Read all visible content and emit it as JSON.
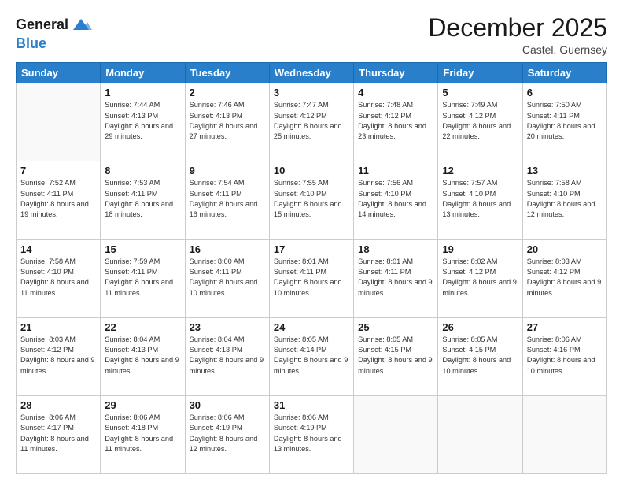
{
  "header": {
    "logo_line1": "General",
    "logo_line2": "Blue",
    "month": "December 2025",
    "location": "Castel, Guernsey"
  },
  "weekdays": [
    "Sunday",
    "Monday",
    "Tuesday",
    "Wednesday",
    "Thursday",
    "Friday",
    "Saturday"
  ],
  "weeks": [
    [
      {
        "day": "",
        "sunrise": "",
        "sunset": "",
        "daylight": ""
      },
      {
        "day": "1",
        "sunrise": "Sunrise: 7:44 AM",
        "sunset": "Sunset: 4:13 PM",
        "daylight": "Daylight: 8 hours and 29 minutes."
      },
      {
        "day": "2",
        "sunrise": "Sunrise: 7:46 AM",
        "sunset": "Sunset: 4:13 PM",
        "daylight": "Daylight: 8 hours and 27 minutes."
      },
      {
        "day": "3",
        "sunrise": "Sunrise: 7:47 AM",
        "sunset": "Sunset: 4:12 PM",
        "daylight": "Daylight: 8 hours and 25 minutes."
      },
      {
        "day": "4",
        "sunrise": "Sunrise: 7:48 AM",
        "sunset": "Sunset: 4:12 PM",
        "daylight": "Daylight: 8 hours and 23 minutes."
      },
      {
        "day": "5",
        "sunrise": "Sunrise: 7:49 AM",
        "sunset": "Sunset: 4:12 PM",
        "daylight": "Daylight: 8 hours and 22 minutes."
      },
      {
        "day": "6",
        "sunrise": "Sunrise: 7:50 AM",
        "sunset": "Sunset: 4:11 PM",
        "daylight": "Daylight: 8 hours and 20 minutes."
      }
    ],
    [
      {
        "day": "7",
        "sunrise": "Sunrise: 7:52 AM",
        "sunset": "Sunset: 4:11 PM",
        "daylight": "Daylight: 8 hours and 19 minutes."
      },
      {
        "day": "8",
        "sunrise": "Sunrise: 7:53 AM",
        "sunset": "Sunset: 4:11 PM",
        "daylight": "Daylight: 8 hours and 18 minutes."
      },
      {
        "day": "9",
        "sunrise": "Sunrise: 7:54 AM",
        "sunset": "Sunset: 4:11 PM",
        "daylight": "Daylight: 8 hours and 16 minutes."
      },
      {
        "day": "10",
        "sunrise": "Sunrise: 7:55 AM",
        "sunset": "Sunset: 4:10 PM",
        "daylight": "Daylight: 8 hours and 15 minutes."
      },
      {
        "day": "11",
        "sunrise": "Sunrise: 7:56 AM",
        "sunset": "Sunset: 4:10 PM",
        "daylight": "Daylight: 8 hours and 14 minutes."
      },
      {
        "day": "12",
        "sunrise": "Sunrise: 7:57 AM",
        "sunset": "Sunset: 4:10 PM",
        "daylight": "Daylight: 8 hours and 13 minutes."
      },
      {
        "day": "13",
        "sunrise": "Sunrise: 7:58 AM",
        "sunset": "Sunset: 4:10 PM",
        "daylight": "Daylight: 8 hours and 12 minutes."
      }
    ],
    [
      {
        "day": "14",
        "sunrise": "Sunrise: 7:58 AM",
        "sunset": "Sunset: 4:10 PM",
        "daylight": "Daylight: 8 hours and 11 minutes."
      },
      {
        "day": "15",
        "sunrise": "Sunrise: 7:59 AM",
        "sunset": "Sunset: 4:11 PM",
        "daylight": "Daylight: 8 hours and 11 minutes."
      },
      {
        "day": "16",
        "sunrise": "Sunrise: 8:00 AM",
        "sunset": "Sunset: 4:11 PM",
        "daylight": "Daylight: 8 hours and 10 minutes."
      },
      {
        "day": "17",
        "sunrise": "Sunrise: 8:01 AM",
        "sunset": "Sunset: 4:11 PM",
        "daylight": "Daylight: 8 hours and 10 minutes."
      },
      {
        "day": "18",
        "sunrise": "Sunrise: 8:01 AM",
        "sunset": "Sunset: 4:11 PM",
        "daylight": "Daylight: 8 hours and 9 minutes."
      },
      {
        "day": "19",
        "sunrise": "Sunrise: 8:02 AM",
        "sunset": "Sunset: 4:12 PM",
        "daylight": "Daylight: 8 hours and 9 minutes."
      },
      {
        "day": "20",
        "sunrise": "Sunrise: 8:03 AM",
        "sunset": "Sunset: 4:12 PM",
        "daylight": "Daylight: 8 hours and 9 minutes."
      }
    ],
    [
      {
        "day": "21",
        "sunrise": "Sunrise: 8:03 AM",
        "sunset": "Sunset: 4:12 PM",
        "daylight": "Daylight: 8 hours and 9 minutes."
      },
      {
        "day": "22",
        "sunrise": "Sunrise: 8:04 AM",
        "sunset": "Sunset: 4:13 PM",
        "daylight": "Daylight: 8 hours and 9 minutes."
      },
      {
        "day": "23",
        "sunrise": "Sunrise: 8:04 AM",
        "sunset": "Sunset: 4:13 PM",
        "daylight": "Daylight: 8 hours and 9 minutes."
      },
      {
        "day": "24",
        "sunrise": "Sunrise: 8:05 AM",
        "sunset": "Sunset: 4:14 PM",
        "daylight": "Daylight: 8 hours and 9 minutes."
      },
      {
        "day": "25",
        "sunrise": "Sunrise: 8:05 AM",
        "sunset": "Sunset: 4:15 PM",
        "daylight": "Daylight: 8 hours and 9 minutes."
      },
      {
        "day": "26",
        "sunrise": "Sunrise: 8:05 AM",
        "sunset": "Sunset: 4:15 PM",
        "daylight": "Daylight: 8 hours and 10 minutes."
      },
      {
        "day": "27",
        "sunrise": "Sunrise: 8:06 AM",
        "sunset": "Sunset: 4:16 PM",
        "daylight": "Daylight: 8 hours and 10 minutes."
      }
    ],
    [
      {
        "day": "28",
        "sunrise": "Sunrise: 8:06 AM",
        "sunset": "Sunset: 4:17 PM",
        "daylight": "Daylight: 8 hours and 11 minutes."
      },
      {
        "day": "29",
        "sunrise": "Sunrise: 8:06 AM",
        "sunset": "Sunset: 4:18 PM",
        "daylight": "Daylight: 8 hours and 11 minutes."
      },
      {
        "day": "30",
        "sunrise": "Sunrise: 8:06 AM",
        "sunset": "Sunset: 4:19 PM",
        "daylight": "Daylight: 8 hours and 12 minutes."
      },
      {
        "day": "31",
        "sunrise": "Sunrise: 8:06 AM",
        "sunset": "Sunset: 4:19 PM",
        "daylight": "Daylight: 8 hours and 13 minutes."
      },
      {
        "day": "",
        "sunrise": "",
        "sunset": "",
        "daylight": ""
      },
      {
        "day": "",
        "sunrise": "",
        "sunset": "",
        "daylight": ""
      },
      {
        "day": "",
        "sunrise": "",
        "sunset": "",
        "daylight": ""
      }
    ]
  ]
}
